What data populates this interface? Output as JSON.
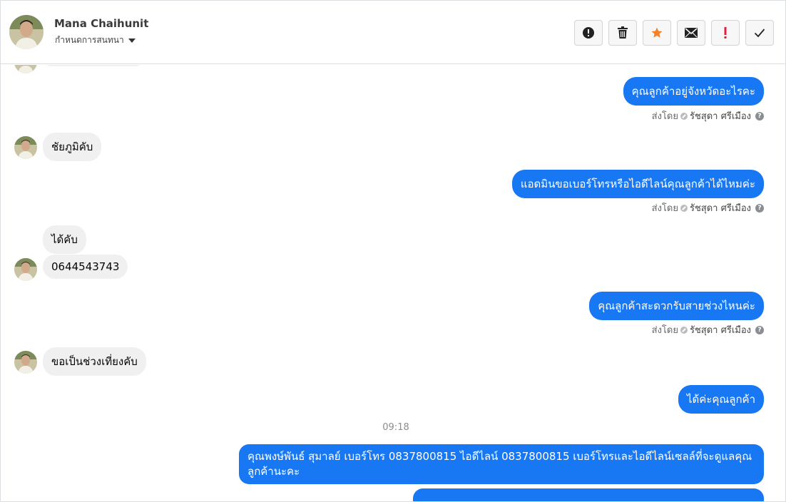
{
  "header": {
    "name": "Mana Chaihunit",
    "status": "กำหนดการสนทนา"
  },
  "toolbar": {
    "buttons": [
      {
        "name": "report-icon",
        "color": "#222222"
      },
      {
        "name": "trash-icon",
        "color": "#222222"
      },
      {
        "name": "star-icon",
        "color": "#f5822a"
      },
      {
        "name": "mail-icon",
        "color": "#222222"
      },
      {
        "name": "exclamation-icon",
        "color": "#e41e3f"
      },
      {
        "name": "check-icon",
        "color": "#222222"
      }
    ]
  },
  "messages": {
    "m1": "คุณลูกค้าอยู่จังหวัดอะไรคะ",
    "m2": "ชัยภูมิคับ",
    "m3": "แอดมินขอเบอร์โทรหรือไอดีไลน์คุณลูกค้าได้ไหมค่ะ",
    "m4": "ได้คับ",
    "m5": "0644543743",
    "m6": "คุณลูกค้าสะดวกรับสายช่วงไหนค่ะ",
    "m7": "ขอเป็นช่วงเที่ยงคับ",
    "m8": "ได้ค่ะคุณลูกค้า",
    "m9": "คุณพงษ์พันธ์ สุมาลย์      เบอร์โทร 0837800815  ไอดีไลน์ 0837800815  เบอร์โทรและไอดีไลน์เซลล์ที่จะดูแลคุณลูกค้านะคะ"
  },
  "sent_by": {
    "label": "ส่งโดย",
    "agent": "รัชสุดา ศรีเมือง",
    "help": "?"
  },
  "timestamp": "09:18",
  "colors": {
    "outgoing": "#1877f2",
    "incoming": "#f0f0f0"
  }
}
